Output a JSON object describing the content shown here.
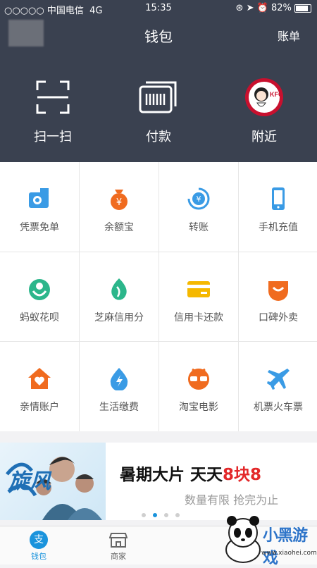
{
  "status": {
    "carrier": "○○○○○ 中国电信",
    "network": "4G",
    "time": "15:35",
    "battery": "82%",
    "battery_level": 0.82
  },
  "header": {
    "title": "钱包",
    "bill_label": "账单"
  },
  "actions": [
    {
      "label": "扫一扫",
      "icon": "scan-icon"
    },
    {
      "label": "付款",
      "icon": "pay-barcode-icon"
    },
    {
      "label": "附近",
      "icon": "kfc-logo-icon"
    }
  ],
  "grid": [
    {
      "label": "凭票免单",
      "icon": "ticket-camera-icon",
      "color": "#3a9be5"
    },
    {
      "label": "余额宝",
      "icon": "money-bag-icon",
      "color": "#f06b1f"
    },
    {
      "label": "转账",
      "icon": "transfer-icon",
      "color": "#3a9be5"
    },
    {
      "label": "手机充值",
      "icon": "phone-icon",
      "color": "#3a9be5"
    },
    {
      "label": "蚂蚁花呗",
      "icon": "huabei-icon",
      "color": "#2cb68b"
    },
    {
      "label": "芝麻信用分",
      "icon": "sesame-icon",
      "color": "#2cb68b"
    },
    {
      "label": "信用卡还款",
      "icon": "credit-card-icon",
      "color": "#f5b800"
    },
    {
      "label": "口碑外卖",
      "icon": "takeout-icon",
      "color": "#f06b1f"
    },
    {
      "label": "亲情账户",
      "icon": "family-house-icon",
      "color": "#f06b1f"
    },
    {
      "label": "生活缴费",
      "icon": "utility-drop-icon",
      "color": "#3a9be5"
    },
    {
      "label": "淘宝电影",
      "icon": "movie-glasses-icon",
      "color": "#f06b1f"
    },
    {
      "label": "机票火车票",
      "icon": "plane-icon",
      "color": "#3a9be5"
    }
  ],
  "banner": {
    "headline_prefix": "暑期大片 天天",
    "headline_red": "8块8",
    "sub": "数量有限  抢完为止",
    "art_text": "旋风"
  },
  "tabs": [
    {
      "label": "钱包",
      "icon": "wallet-icon",
      "active": true
    },
    {
      "label": "商家",
      "icon": "shop-icon",
      "active": false
    }
  ],
  "watermark": {
    "text": "小黑游戏",
    "url": "www.xiaohei.com"
  },
  "colors": {
    "header_bg": "#3a4150",
    "accent": "#1a93dc",
    "headline_red": "#e3282a"
  }
}
